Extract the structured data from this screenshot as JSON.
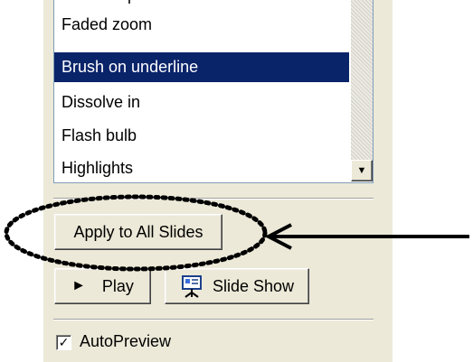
{
  "effects_list": {
    "partial_item": "Faded wipe",
    "items": [
      {
        "label": "Faded zoom",
        "selected": false
      },
      {
        "label": "Brush on underline",
        "selected": true
      },
      {
        "label": "Dissolve in",
        "selected": false
      },
      {
        "label": "Flash bulb",
        "selected": false
      },
      {
        "label": "Highlights",
        "selected": false
      }
    ],
    "scroll_down_glyph": "▼"
  },
  "buttons": {
    "apply_all": "Apply to All Slides",
    "play": "Play",
    "play_glyph": "►",
    "slide_show": "Slide Show"
  },
  "autopreview": {
    "label": "AutoPreview",
    "checked": true,
    "check_glyph": "✓"
  },
  "colors": {
    "panel_bg": "#ece9d8",
    "selection_bg": "#0a246a",
    "selection_text": "#ffffff",
    "annotation": "#000000"
  },
  "icons": {
    "play": "play-triangle-icon",
    "slide_show": "projector-screen-icon",
    "scroll_down": "chevron-down-icon",
    "checkbox": "checkmark-icon"
  }
}
